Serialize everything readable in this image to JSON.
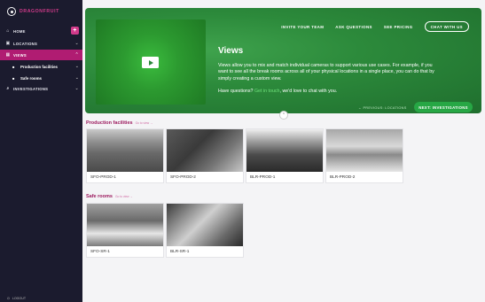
{
  "brand": {
    "name": "DRAGONFRUIT"
  },
  "sidebar": {
    "items": [
      {
        "icon": "home-icon",
        "label": "HOME",
        "has_add": true
      },
      {
        "icon": "camera-icon",
        "label": "LOCATIONS",
        "chevron": "⌄"
      },
      {
        "icon": "grid-icon",
        "label": "VIEWS",
        "chevron": "⌃",
        "active": true
      },
      {
        "icon": "film-icon",
        "label": "Production facilities",
        "chevron": "⌄",
        "sub": true
      },
      {
        "icon": "film-icon",
        "label": "Safe rooms",
        "chevron": "⌄",
        "sub": true
      },
      {
        "icon": "search-icon",
        "label": "INVESTIGATIONS",
        "chevron": "⌄"
      }
    ],
    "add_label": "+",
    "footer_label": "LOGOUT"
  },
  "hero": {
    "links": [
      "INVITE YOUR TEAM",
      "ASK QUESTIONS",
      "SEE PRICING"
    ],
    "chat_label": "CHAT WITH US",
    "title": "Views",
    "description": "Views allow you to mix and match individual cameras to support various use cases. For example, if you want to see all the break rooms across all of your physical locations in a single place, you can do that by simply creating a custom view.",
    "question_prefix": "Have questions? ",
    "question_link": "Get in touch",
    "question_suffix": ", we'd love to chat with you.",
    "prev_label": "← PREVIOUS: LOCATIONS",
    "next_label": "NEXT: INVESTIGATIONS"
  },
  "sections": [
    {
      "title": "Production facilities",
      "see_all": "Go to view →",
      "cameras": [
        {
          "label": "SFO-PROD-1"
        },
        {
          "label": "SFO-PROD-2"
        },
        {
          "label": "BLR-PROD-1"
        },
        {
          "label": "BLR-PROD-2"
        }
      ]
    },
    {
      "title": "Safe rooms",
      "see_all": "Go to view →",
      "cameras": [
        {
          "label": "SFO-SR-1"
        },
        {
          "label": "BLR-SR-1"
        }
      ]
    }
  ]
}
